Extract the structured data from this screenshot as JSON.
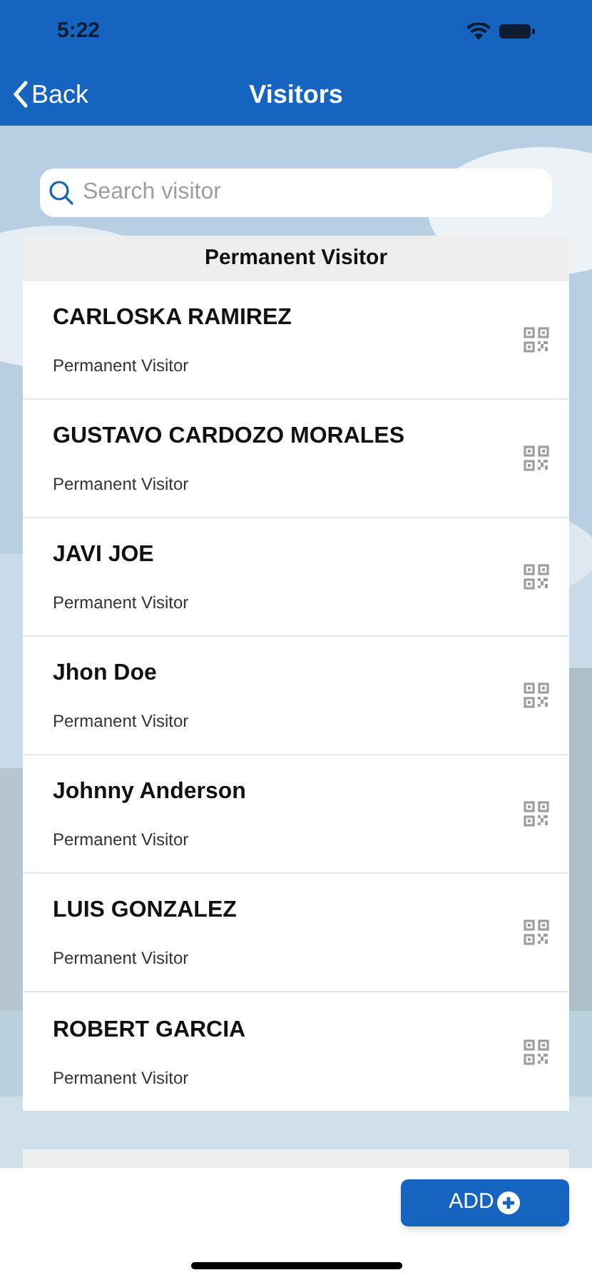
{
  "status_bar": {
    "time": "5:22"
  },
  "nav": {
    "back": "Back",
    "title": "Visitors"
  },
  "search": {
    "placeholder": "Search visitor"
  },
  "sections": [
    {
      "kind": "list",
      "title": "Permanent Visitor",
      "visitors": [
        {
          "name": "CARLOSKA RAMIREZ",
          "type": "Permanent Visitor"
        },
        {
          "name": "GUSTAVO CARDOZO MORALES",
          "type": "Permanent Visitor"
        },
        {
          "name": "JAVI JOE",
          "type": "Permanent Visitor"
        },
        {
          "name": "Jhon Doe",
          "type": "Permanent Visitor"
        },
        {
          "name": "Johnny Anderson",
          "type": "Permanent Visitor"
        },
        {
          "name": "LUIS GONZALEZ",
          "type": "Permanent Visitor"
        },
        {
          "name": "ROBERT GARCIA",
          "type": "Permanent Visitor"
        }
      ]
    },
    {
      "kind": "cut_off"
    }
  ],
  "add_button": "ADD"
}
